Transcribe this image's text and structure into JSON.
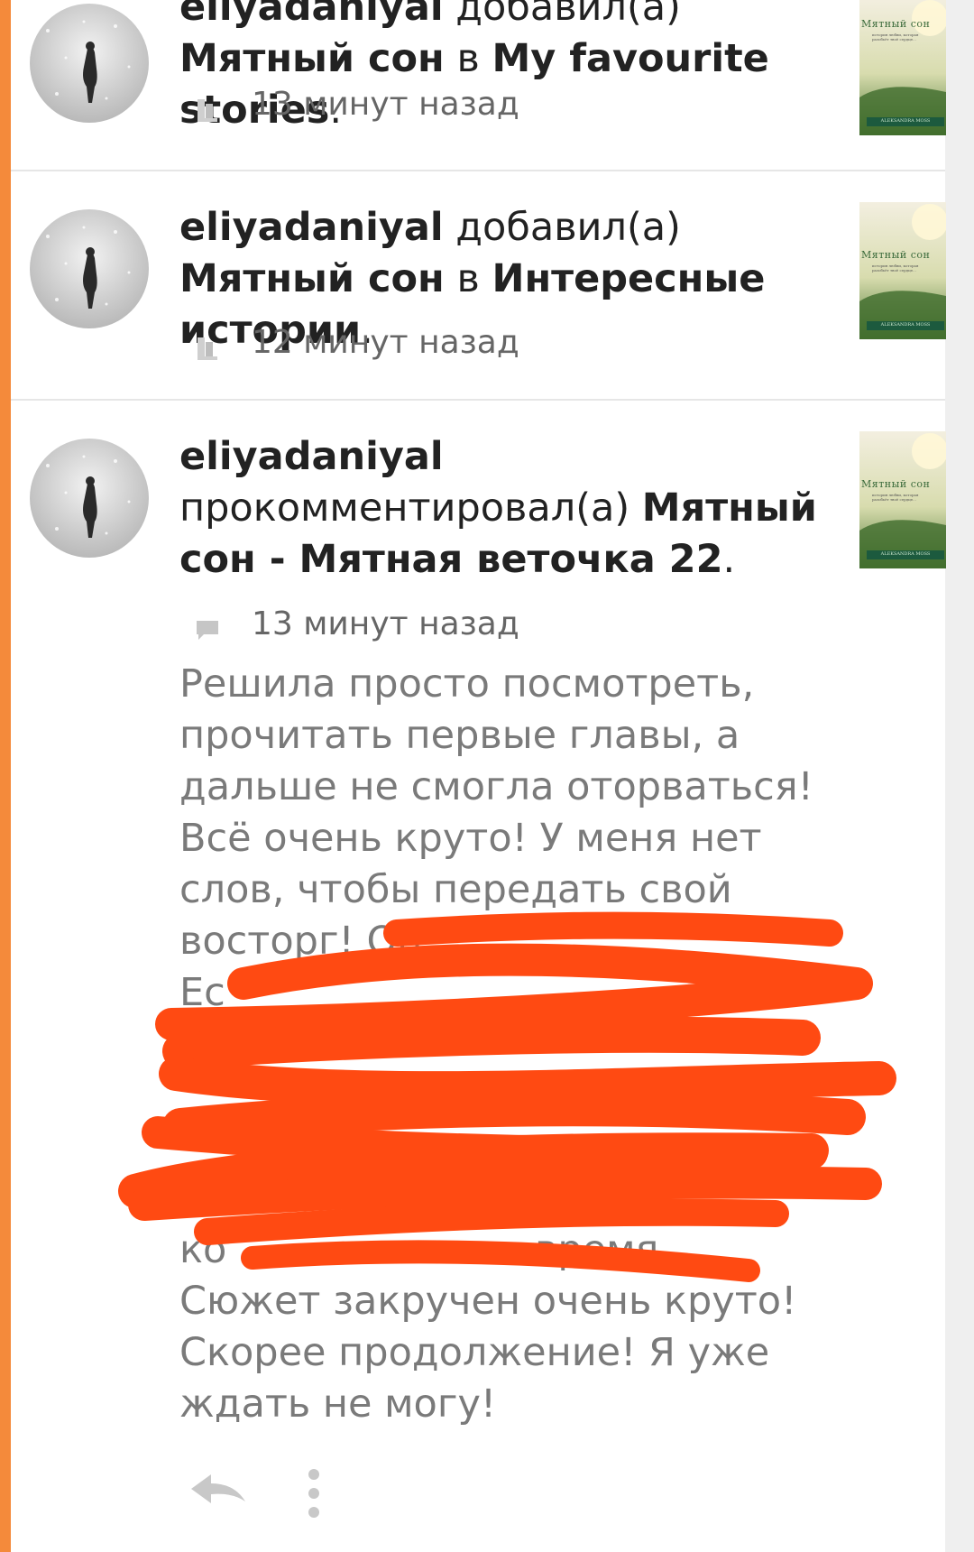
{
  "feed": {
    "items": [
      {
        "user": "eliyadaniyal",
        "action": "добавил(а)",
        "book": "Мятный сон",
        "connector": "в",
        "target": "My favourite stories",
        "time": "13 минут назад",
        "meta_icon": "library-icon",
        "cover": {
          "title": "Мятный сон",
          "tagline": "история любви, которая разобьёт твоё сердце...",
          "author": "ALEKSANDRA MOSS"
        }
      },
      {
        "user": "eliyadaniyal",
        "action": "добавил(а)",
        "book": "Мятный сон",
        "connector": "в",
        "target": "Интересные истории",
        "time": "12 минут назад",
        "meta_icon": "library-icon",
        "cover": {
          "title": "Мятный сон",
          "tagline": "история любви, которая разобьёт твоё сердце...",
          "author": "ALEKSANDRA MOSS"
        }
      },
      {
        "user": "eliyadaniyal",
        "action": "прокомментировал(а)",
        "target": "Мятный сон - Мятная веточка 22",
        "time": "13 минут назад",
        "meta_icon": "comment-icon",
        "comment_lines": [
          "Решила просто посмотреть,",
          "прочитать первые главы, а",
          "дальше не смогла оторваться!",
          "Всё очень круто! У меня нет",
          "слов, чтобы передать свой",
          "восторг! Он",
          "Ес",
          "",
          "",
          "",
          "",
          "ко                         время.",
          "Сюжет закручен очень круто!",
          "Скорее продолжение! Я уже",
          "ждать не могу!"
        ],
        "cover": {
          "title": "Мятный сон",
          "tagline": "история любви, которая разобьёт твоё сердце...",
          "author": "ALEKSANDRA MOSS"
        }
      }
    ]
  },
  "actions": {
    "reply_icon": "reply-icon",
    "more_icon": "more-vertical-icon"
  },
  "colors": {
    "accent": "#f48a3b",
    "redaction": "#ff4a12",
    "text": "#222222",
    "meta": "#666666",
    "comment": "#7a7a7a"
  }
}
